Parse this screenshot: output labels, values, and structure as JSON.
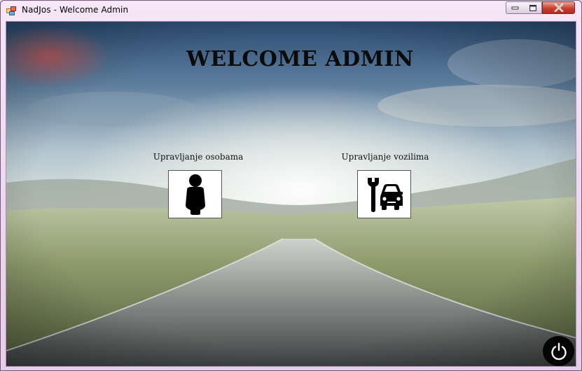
{
  "window": {
    "title": "NadJos - Welcome Admin",
    "controls": {
      "minimize": "minimize",
      "maximize": "maximize",
      "close": "close"
    }
  },
  "main": {
    "heading": "WELCOME ADMIN",
    "tiles": [
      {
        "label": "Upravljanje osobama",
        "icon": "person-icon"
      },
      {
        "label": "Upravljanje vozilima",
        "icon": "car-service-icon"
      }
    ],
    "power_icon": "power-icon"
  }
}
